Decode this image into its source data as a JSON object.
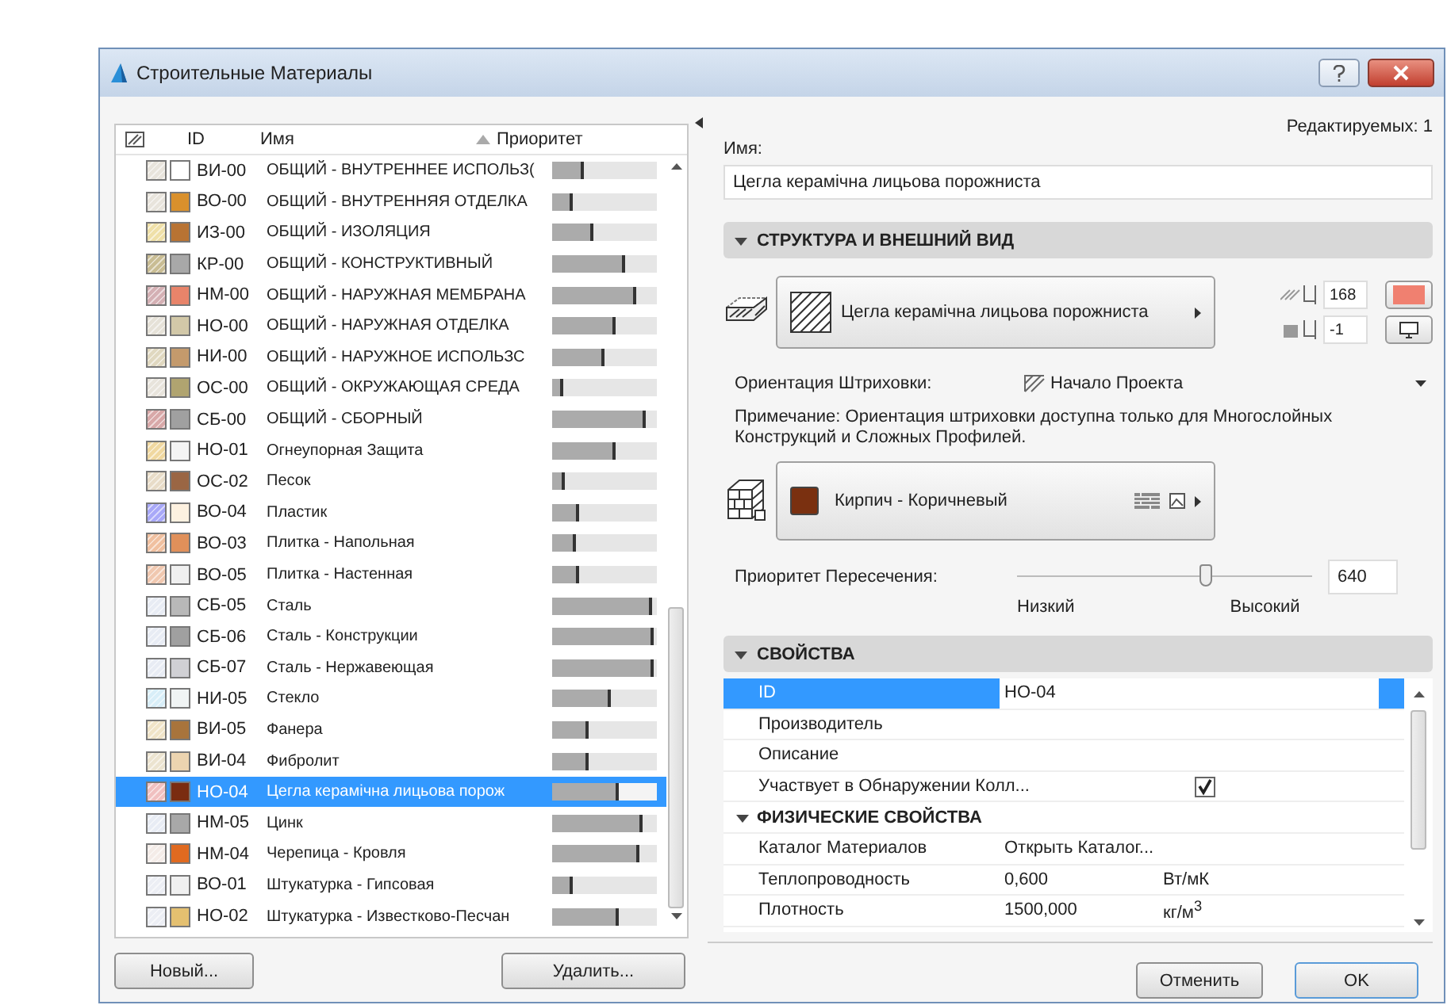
{
  "window": {
    "title": "Строительные Материалы"
  },
  "list": {
    "columns": [
      "ID",
      "Имя",
      "Приоритет"
    ],
    "rows": [
      {
        "id": "ВИ-00",
        "name": "ОБЩИЙ - ВНУТРЕННЕЕ ИСПОЛЬЗ(",
        "level": 0.31,
        "hatch": {
          "color": "#e8e4dc"
        },
        "color": "#ffffff",
        "selected": false
      },
      {
        "id": "ВО-00",
        "name": "ОБЩИЙ - ВНУТРЕННЯЯ ОТДЕЛКА",
        "level": 0.2,
        "hatch": {
          "color": "#e8e4dc"
        },
        "color": "#d9902c",
        "selected": false
      },
      {
        "id": "ИЗ-00",
        "name": "ОБЩИЙ - ИЗОЛЯЦИЯ",
        "level": 0.4,
        "hatch": {
          "color": "#efe0a8"
        },
        "color": "#b87333",
        "selected": false
      },
      {
        "id": "КР-00",
        "name": "ОБЩИЙ - КОНСТРУКТИВНЫЙ",
        "level": 0.7,
        "hatch": {
          "color": "#c9bd94"
        },
        "color": "#a8a8a8",
        "selected": false
      },
      {
        "id": "НМ-00",
        "name": "ОБЩИЙ - НАРУЖНАЯ МЕМБРАНА",
        "level": 0.8,
        "hatch": {
          "color": "#d4b0b4"
        },
        "color": "#e8846a",
        "selected": false
      },
      {
        "id": "НО-00",
        "name": "ОБЩИЙ - НАРУЖНАЯ ОТДЕЛКА",
        "level": 0.6,
        "hatch": {
          "color": "#e6e2d8"
        },
        "color": "#d2c8a8",
        "selected": false
      },
      {
        "id": "НИ-00",
        "name": "ОБЩИЙ - НАРУЖНОЕ ИСПОЛЬЗС",
        "level": 0.5,
        "hatch": {
          "color": "#e0d8c0"
        },
        "color": "#c49a6c",
        "selected": false
      },
      {
        "id": "ОС-00",
        "name": "ОБЩИЙ - ОКРУЖАЮЩАЯ СРЕДА",
        "level": 0.1,
        "hatch": {
          "color": "#e8e4dc"
        },
        "color": "#b0a470",
        "selected": false
      },
      {
        "id": "СБ-00",
        "name": "ОБЩИЙ - СБОРНЫЙ",
        "level": 0.9,
        "hatch": {
          "color": "#d8a8a8"
        },
        "color": "#a0a0a0",
        "selected": false
      },
      {
        "id": "НО-01",
        "name": "Огнеупорная Защита",
        "level": 0.61,
        "hatch": {
          "color": "#f0d8a0"
        },
        "color": "#f4f4f4",
        "selected": false
      },
      {
        "id": "ОС-02",
        "name": "Песок",
        "level": 0.12,
        "hatch": {
          "color": "#e8dcc8"
        },
        "color": "#9a6644",
        "selected": false
      },
      {
        "id": "ВО-04",
        "name": "Пластик",
        "level": 0.25,
        "hatch": {
          "color": "#a8a8f8"
        },
        "color": "#fdf1e0",
        "selected": false
      },
      {
        "id": "ВО-03",
        "name": "Плитка - Напольная",
        "level": 0.23,
        "hatch": {
          "color": "#f0c0a0"
        },
        "color": "#e0905a",
        "selected": false
      },
      {
        "id": "ВО-05",
        "name": "Плитка - Настенная",
        "level": 0.25,
        "hatch": {
          "color": "#f0c8b0"
        },
        "color": "#f0f0f0",
        "selected": false
      },
      {
        "id": "СБ-05",
        "name": "Сталь",
        "level": 0.95,
        "hatch": {
          "color": "#e8ecf4"
        },
        "color": "#b8b8b8",
        "selected": false
      },
      {
        "id": "СБ-06",
        "name": "Сталь - Конструкции",
        "level": 0.97,
        "hatch": {
          "color": "#e8ecf4"
        },
        "color": "#a0a0a0",
        "selected": false
      },
      {
        "id": "СБ-07",
        "name": "Сталь - Нержавеющая",
        "level": 0.97,
        "hatch": {
          "color": "#e8ecf4"
        },
        "color": "#d0d0d4",
        "selected": false
      },
      {
        "id": "НИ-05",
        "name": "Стекло",
        "level": 0.56,
        "hatch": {
          "color": "#d8eef8"
        },
        "color": "#f0f4f4",
        "selected": false
      },
      {
        "id": "ВИ-05",
        "name": "Фанера",
        "level": 0.35,
        "hatch": {
          "color": "#f0e4c8"
        },
        "color": "#a8743c",
        "selected": false
      },
      {
        "id": "ВИ-04",
        "name": "Фибролит",
        "level": 0.35,
        "hatch": {
          "color": "#ece4d0"
        },
        "color": "#ecd4b0",
        "selected": false
      },
      {
        "id": "НО-04",
        "name": "Цегла керамічна лицьова порож",
        "level": 0.64,
        "hatch": {
          "color": "#f0c0c0"
        },
        "color": "#7a2c10",
        "selected": true
      },
      {
        "id": "НМ-05",
        "name": "Цинк",
        "level": 0.86,
        "hatch": {
          "color": "#e8ecf4"
        },
        "color": "#a8a8a8",
        "selected": false
      },
      {
        "id": "НМ-04",
        "name": "Черепица - Кровля",
        "level": 0.84,
        "hatch": {
          "color": "#f4ece8"
        },
        "color": "#e06a20",
        "selected": false
      },
      {
        "id": "ВО-01",
        "name": "Штукатурка - Гипсовая",
        "level": 0.2,
        "hatch": {
          "color": "#eceef4"
        },
        "color": "#f0f0f0",
        "selected": false
      },
      {
        "id": "НО-02",
        "name": "Штукатурка - Известково-Песчан",
        "level": 0.63,
        "hatch": {
          "color": "#eceef4"
        },
        "color": "#e4c070",
        "selected": false
      }
    ]
  },
  "list_buttons": [
    "Новый...",
    "Удалить..."
  ],
  "editable_count": "Редактируемых: 1",
  "name_field": {
    "label": "Имя:",
    "value": "Цегла керамічна лицьова порожниста"
  },
  "structure": {
    "title": "СТРУКТУРА И ВНЕШНИЙ ВИД",
    "expanded": true,
    "fill_name": "Цегла керамічна лицьова порожниста",
    "pen_value": "168",
    "pen": {
      "color": "#f08070"
    },
    "background_value": "-1",
    "orientation_label": "Ориентация Штриховки:",
    "orientation_value": "Начало Проекта",
    "note": "Примечание: Ориентация штриховки доступна только для Многослойных Конструкций и Сложных Профилей.",
    "surface_name": "Кирпич - Коричневый",
    "surface": {
      "color": "#7a3010"
    },
    "priority_label": "Приоритет Пересечения:",
    "level": 0.64,
    "priority_value": "640",
    "low_label": "Низкий",
    "high_label": "Высокий"
  },
  "properties": {
    "title": "СВОЙСТВА",
    "expanded": true,
    "rows": [
      {
        "kind": "field",
        "label": "ID",
        "value": "НО-04",
        "selected": true
      },
      {
        "kind": "field",
        "label": "Производитель",
        "selected": false
      },
      {
        "kind": "field",
        "label": "Описание",
        "selected": false
      },
      {
        "kind": "checkbox",
        "label": "Участвует в Обнаружении Колл...",
        "checked": true,
        "selected": false
      },
      {
        "kind": "group",
        "label": "ФИЗИЧЕСКИЕ СВОЙСТВА",
        "expanded": true
      },
      {
        "kind": "field",
        "label": "Каталог Материалов",
        "value": "Открыть Каталог...",
        "selected": false
      },
      {
        "kind": "field",
        "label": "Теплопроводность",
        "value": "0,600",
        "unit": "Вт/мК",
        "selected": false
      },
      {
        "kind": "field",
        "label": "Плотность",
        "value": "1500,000",
        "unit": "кг/м$^{3}$",
        "selected": false
      }
    ]
  },
  "buttons": [
    "Отменить",
    "OK"
  ]
}
